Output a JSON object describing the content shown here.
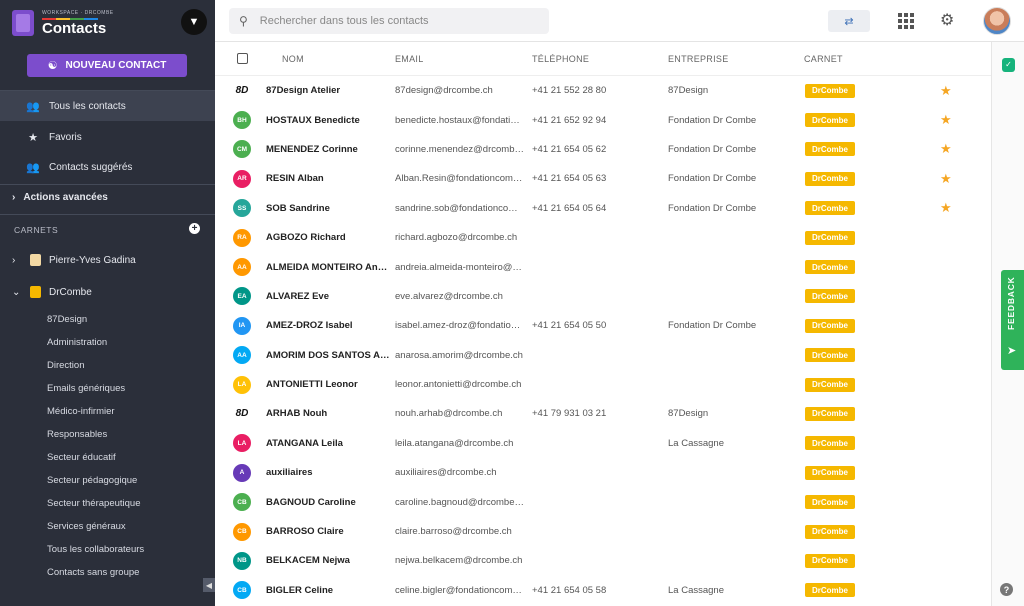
{
  "brand": {
    "subtitle": "WORKSPACE · DRCOMBE",
    "title": "Contacts",
    "bar_colors": [
      "#e53935",
      "#fbc02d",
      "#43a047",
      "#1e88e5"
    ]
  },
  "sidebar": {
    "new_contact_label": "NOUVEAU CONTACT",
    "nav": [
      {
        "label": "Tous les contacts",
        "icon": "people-icon"
      },
      {
        "label": "Favoris",
        "icon": "star-icon"
      },
      {
        "label": "Contacts suggérés",
        "icon": "suggested-contacts-icon"
      }
    ],
    "advanced_label": "Actions avancées",
    "carnets_label": "CARNETS",
    "books": [
      {
        "label": "Pierre-Yves Gadina",
        "color": "#f3d9a4"
      },
      {
        "label": "DrCombe",
        "color": "#f5b800"
      }
    ],
    "groups": [
      "87Design",
      "Administration",
      "Direction",
      "Emails génériques",
      "Médico-infirmier",
      "Responsables",
      "Secteur éducatif",
      "Secteur pédagogique",
      "Secteur thérapeutique",
      "Services généraux",
      "Tous les collaborateurs",
      "Contacts sans groupe"
    ]
  },
  "search": {
    "placeholder": "Rechercher dans tous les contacts"
  },
  "table": {
    "headers": {
      "name": "NOM",
      "email": "EMAIL",
      "phone": "TÉLÉPHONE",
      "company": "ENTREPRISE",
      "book": "CARNET"
    },
    "rows": [
      {
        "initials": "8D",
        "logo": true,
        "color": "",
        "name": "87Design Atelier",
        "email": "87design@drcombe.ch",
        "phone": "+41 21 552 28 80",
        "company": "87Design",
        "book": "DrCombe",
        "fav": true
      },
      {
        "initials": "BH",
        "color": "#4caf50",
        "name": "HOSTAUX Benedicte",
        "email": "benedicte.hostaux@fondationcombe.ch",
        "phone": "+41 21 652 92 94",
        "company": "Fondation Dr Combe",
        "book": "DrCombe",
        "fav": true
      },
      {
        "initials": "CM",
        "color": "#4caf50",
        "name": "MENENDEZ Corinne",
        "email": "corinne.menendez@drcombe.ch",
        "phone": "+41 21 654 05 62",
        "company": "Fondation Dr Combe",
        "book": "DrCombe",
        "fav": true
      },
      {
        "initials": "AR",
        "color": "#e91e63",
        "name": "RESIN Alban",
        "email": "Alban.Resin@fondationcombe.ch",
        "phone": "+41 21 654 05 63",
        "company": "Fondation Dr Combe",
        "book": "DrCombe",
        "fav": true
      },
      {
        "initials": "SS",
        "color": "#26a69a",
        "name": "SOB Sandrine",
        "email": "sandrine.sob@fondationcombe.ch",
        "phone": "+41 21 654 05 64",
        "company": "Fondation Dr Combe",
        "book": "DrCombe",
        "fav": true
      },
      {
        "initials": "RA",
        "color": "#ff9800",
        "name": "AGBOZO Richard",
        "email": "richard.agbozo@drcombe.ch",
        "phone": "",
        "company": "",
        "book": "DrCombe",
        "fav": false
      },
      {
        "initials": "AA",
        "color": "#ff9800",
        "name": "ALMEIDA MONTEIRO Andreia",
        "email": "andreia.almeida-monteiro@drcombe.ch",
        "phone": "",
        "company": "",
        "book": "DrCombe",
        "fav": false
      },
      {
        "initials": "EA",
        "color": "#009688",
        "name": "ALVAREZ Eve",
        "email": "eve.alvarez@drcombe.ch",
        "phone": "",
        "company": "",
        "book": "DrCombe",
        "fav": false
      },
      {
        "initials": "IA",
        "color": "#2196f3",
        "name": "AMEZ-DROZ Isabel",
        "email": "isabel.amez-droz@fondationcombe.ch",
        "phone": "+41 21 654 05 50",
        "company": "Fondation Dr Combe",
        "book": "DrCombe",
        "fav": false
      },
      {
        "initials": "AA",
        "color": "#03a9f4",
        "name": "AMORIM DOS SANTOS Anarosa",
        "email": "anarosa.amorim@drcombe.ch",
        "phone": "",
        "company": "",
        "book": "DrCombe",
        "fav": false
      },
      {
        "initials": "LA",
        "color": "#ffc107",
        "name": "ANTONIETTI Leonor",
        "email": "leonor.antonietti@drcombe.ch",
        "phone": "",
        "company": "",
        "book": "DrCombe",
        "fav": false
      },
      {
        "initials": "8D",
        "logo": true,
        "color": "",
        "name": "ARHAB Nouh",
        "email": "nouh.arhab@drcombe.ch",
        "phone": "+41 79 931 03 21",
        "company": "87Design",
        "book": "DrCombe",
        "fav": false
      },
      {
        "initials": "LA",
        "color": "#e91e63",
        "name": "ATANGANA Leila",
        "email": "leila.atangana@drcombe.ch",
        "phone": "",
        "company": "La Cassagne",
        "book": "DrCombe",
        "fav": false
      },
      {
        "initials": "A",
        "color": "#673ab7",
        "name": "auxiliaires",
        "email": "auxiliaires@drcombe.ch",
        "phone": "",
        "company": "",
        "book": "DrCombe",
        "fav": false
      },
      {
        "initials": "CB",
        "color": "#4caf50",
        "name": "BAGNOUD Caroline",
        "email": "caroline.bagnoud@drcombe.ch",
        "phone": "",
        "company": "",
        "book": "DrCombe",
        "fav": false
      },
      {
        "initials": "CB",
        "color": "#ff9800",
        "name": "BARROSO Claire",
        "email": "claire.barroso@drcombe.ch",
        "phone": "",
        "company": "",
        "book": "DrCombe",
        "fav": false
      },
      {
        "initials": "NB",
        "color": "#009688",
        "name": "BELKACEM Nejwa",
        "email": "nejwa.belkacem@drcombe.ch",
        "phone": "",
        "company": "",
        "book": "DrCombe",
        "fav": false
      },
      {
        "initials": "CB",
        "color": "#03a9f4",
        "name": "BIGLER Celine",
        "email": "celine.bigler@fondationcombe.ch",
        "phone": "+41 21 654 05 58",
        "company": "La Cassagne",
        "book": "DrCombe",
        "fav": false
      }
    ]
  },
  "feedback": {
    "label": "FEEDBACK"
  },
  "help": {
    "label": "?"
  }
}
